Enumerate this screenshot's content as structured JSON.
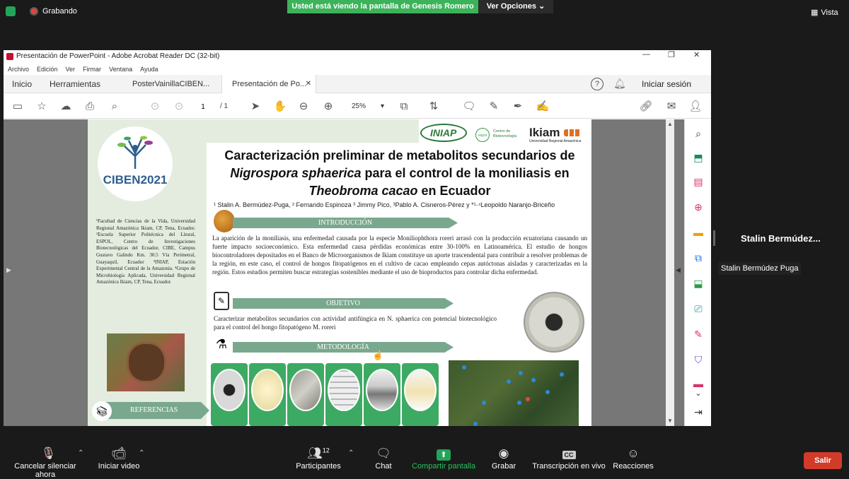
{
  "zoom": {
    "recording": "Grabando",
    "share_banner": "Usted está viendo la pantalla de Genesis Romero",
    "view_options": "Ver Opciones",
    "vista": "Vista",
    "participant_name": "Stalin  Bermúdez...",
    "participant_tooltip": "Stalin Bermúdez Puga",
    "bottom": {
      "mute": "Cancelar silenciar ahora",
      "video": "Iniciar video",
      "participants": "Participantes",
      "participants_count": "12",
      "chat": "Chat",
      "share": "Compartir pantalla",
      "record": "Grabar",
      "transcript": "Transcripción en vivo",
      "reactions": "Reacciones",
      "leave": "Salir"
    }
  },
  "acrobat": {
    "title": "Presentación de PowerPoint - Adobe Acrobat Reader DC (32-bit)",
    "menu": [
      "Archivo",
      "Edición",
      "Ver",
      "Firmar",
      "Ventana",
      "Ayuda"
    ],
    "tabs": {
      "home": "Inicio",
      "tools": "Herramientas",
      "doc1": "PosterVainillaCIBEN...",
      "doc2": "Presentación de Po..."
    },
    "signin": "Iniciar sesión",
    "page_current": "1",
    "page_total": "/ 1",
    "zoom_level": "25%"
  },
  "poster": {
    "title_line1": "Caracterización preliminar de metabolitos secundarios de",
    "title_line2_italic": "Nigrospora sphaerica",
    "title_line2_rest": " para el control de la moniliasis en",
    "title_line3_italic": "Theobroma cacao",
    "title_line3_rest": " en Ecuador",
    "authors": "¹ Stalin A. Bermúdez-Puga, ² Fernando Espinoza ³ Jimmy Pico, ³Pablo A. Cisneros-Pérez  y  *¹·⁴Leopoldo Naranjo-Briceño",
    "logo_ciben": "CIBEN2021",
    "logo_iniap": "INIAP",
    "logo_espol": "espol",
    "logo_espol_sub": "Centro de Biotecnología",
    "logo_ikiam": "Ikiam",
    "logo_ikiam_sub": "Universidad Regional Amazónica",
    "affiliations": "¹Facultad de Ciencias de la Vida, Universidad Regional Amazónica Ikiam, CP, Tena, Ecuador. ²Escuela Superior Politécnica del Litoral, ESPOL, Centro de Investigaciones Biotecnológicas del Ecuador, CIBE, Campus Gustavo Galindo Km. 30.5 Vía Perimetral, Guayaquil, Ecuador ³INIAP, Estación Experimental Central de la Amazonía. ⁴Grupo de Microbiología Aplicada, Universidad Regional Amazónica Ikiam, CP, Tena, Ecuador.",
    "sec_intro": "INTRODUCCIÓN",
    "intro_text": "La aparición de la moniliasis, una enfermedad causada por la especie Moniliophthora roreri arrasó con la producción ecuatoriana causando un fuerte impacto socioeconómico. Esta enfermedad causa pérdidas económicas entre 30-100% en Latinoamérica. El estudio de hongos biocontroladores depositados en el Banco de Microorganismos de Ikiam constituye un aporte trascendental para contribuir a resolver problemas de la región, en este caso, el control de hongos fitopatógenos en el  cultivo de cacao empleando cepas autóctonas aisladas y caracterizadas en la región. Estos estudios permiten buscar estrategias sostenibles mediante el uso de bioproductos para controlar dicha enfermedad.",
    "sec_obj": "OBJETIVO",
    "obj_text": "Caracterizar metabolitos secundarios con actividad antifúngica en N. sphaerica con potencial biotecnológico para el control del hongo fitopatógeno M. roreri",
    "sec_met": "METODOLOGÍA",
    "sec_ref": "REFERENCIAS"
  },
  "colors": {
    "ribbon": "#7aa88e",
    "zoom_green": "#3cb35a",
    "leave_red": "#d13b2a",
    "acrobat_blue": "#1473e6"
  }
}
